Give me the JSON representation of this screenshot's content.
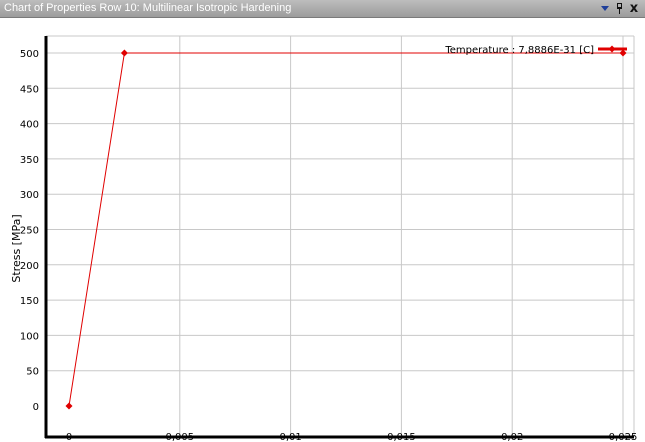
{
  "window": {
    "title": "Chart of Properties Row 10: Multilinear Isotropic Hardening",
    "close_glyph": "x",
    "icons": [
      "chevron-down-icon",
      "pin-icon",
      "close-icon"
    ]
  },
  "chart_data": {
    "type": "line",
    "title": "",
    "xlabel": "",
    "ylabel": "Stress  [MPa]",
    "xlim": [
      0,
      0.025
    ],
    "ylim": [
      0,
      500
    ],
    "xticks": [
      0,
      0.005,
      0.01,
      0.015,
      0.02,
      0.025
    ],
    "xtick_labels": [
      "0",
      "0,005",
      "0,01",
      "0,015",
      "0,02",
      "0,025"
    ],
    "yticks": [
      0,
      50,
      100,
      150,
      200,
      250,
      300,
      350,
      400,
      450,
      500
    ],
    "ytick_labels": [
      "0",
      "50",
      "100",
      "150",
      "200",
      "250",
      "300",
      "350",
      "400",
      "450",
      "500"
    ],
    "grid": true,
    "legend_position": "top-right",
    "series": [
      {
        "name": "Temperature : 7,8886E-31 [C]",
        "color": "#e00000",
        "x": [
          0,
          0.0025,
          0.025
        ],
        "y": [
          0,
          500,
          500
        ]
      }
    ]
  }
}
